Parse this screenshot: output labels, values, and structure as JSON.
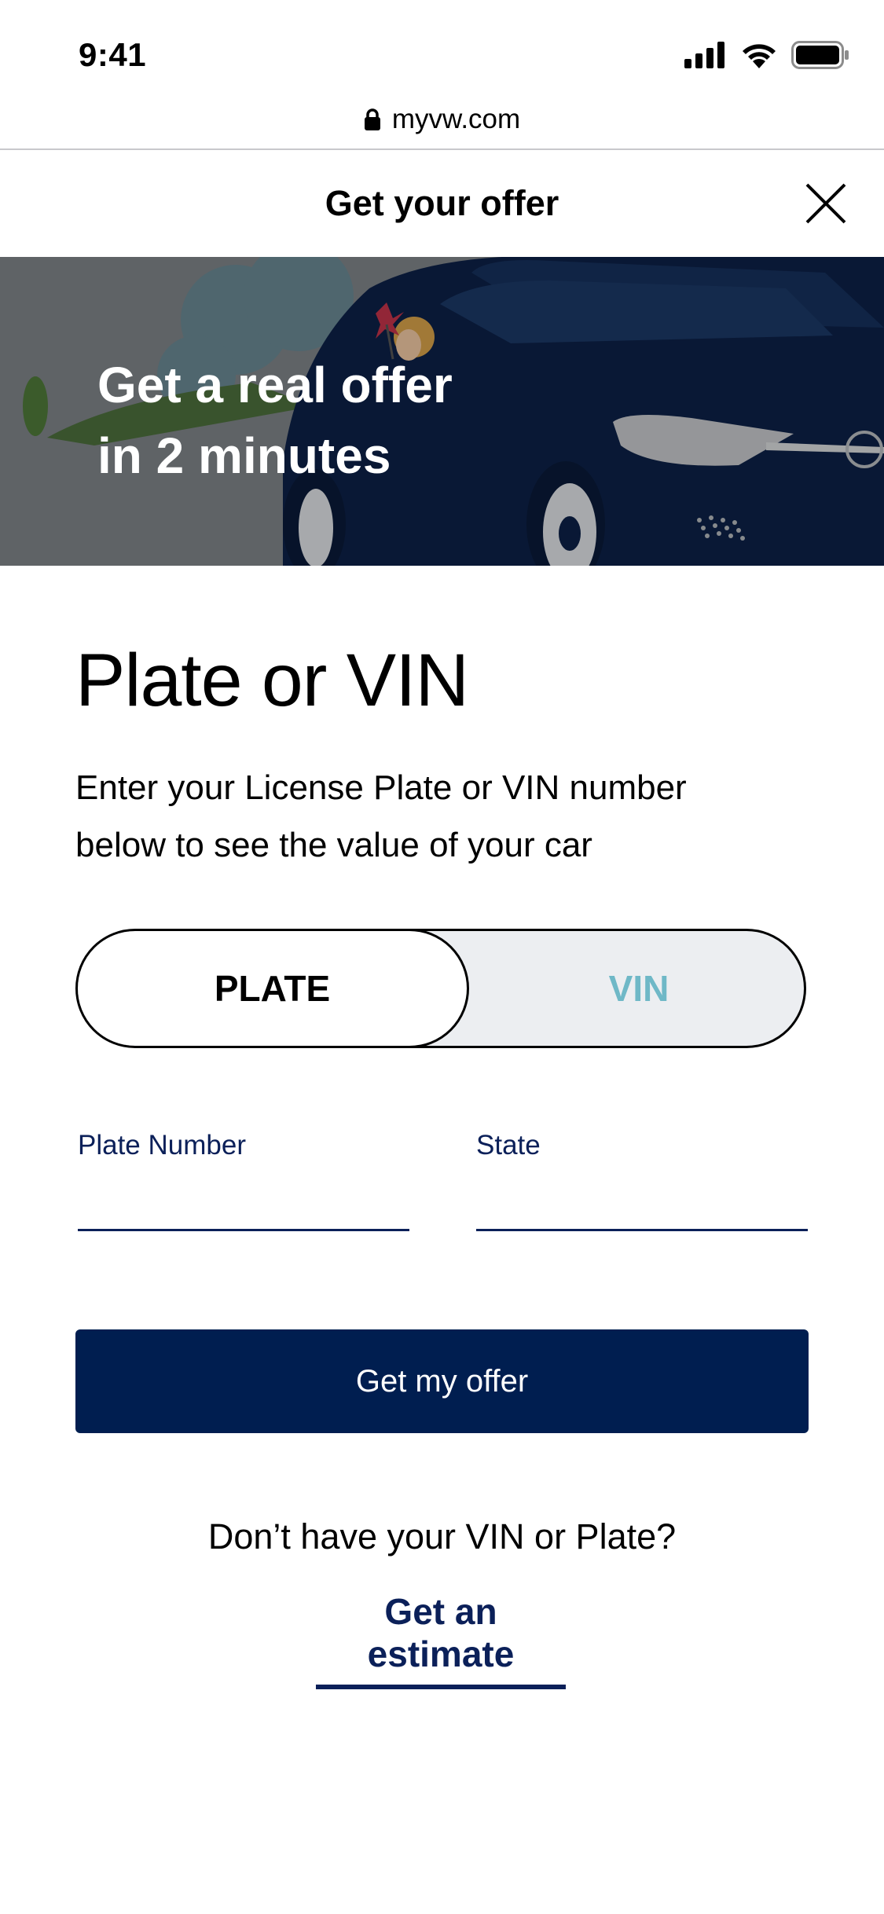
{
  "status_bar": {
    "time": "9:41"
  },
  "browser": {
    "url": "myvw.com"
  },
  "header": {
    "title": "Get your offer"
  },
  "hero": {
    "line1": "Get a real offer",
    "line2": "in 2 minutes"
  },
  "main": {
    "title": "Plate or VIN",
    "description_line1": "Enter your License Plate or VIN number",
    "description_line2": "below to see the value of your car"
  },
  "toggle": {
    "selected": "PLATE",
    "options": [
      "PLATE",
      "VIN"
    ]
  },
  "form": {
    "plate_label": "Plate Number",
    "plate_value": "",
    "state_label": "State",
    "state_value": ""
  },
  "cta": {
    "label": "Get my offer"
  },
  "footer": {
    "question": "Don’t have your VIN or Plate?",
    "link": "Get an estimate"
  },
  "colors": {
    "brand_navy": "#001e50",
    "label_navy": "#0b2059",
    "vin_teal": "#6fb8c7",
    "toggle_bg": "#eceef1"
  },
  "icons": [
    "signal-icon",
    "wifi-icon",
    "battery-icon",
    "lock-icon",
    "close-icon"
  ]
}
